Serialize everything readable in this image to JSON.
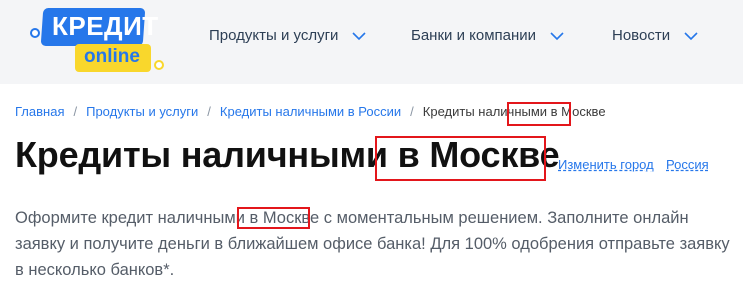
{
  "header": {
    "logo": {
      "top": "КРЕДИТ",
      "bottom": "online"
    },
    "nav": [
      {
        "label": "Продукты и услуги",
        "icon": "chevron-down-icon"
      },
      {
        "label": "Банки и компании",
        "icon": "chevron-down-icon"
      },
      {
        "label": "Новости",
        "icon": "chevron-down-icon"
      }
    ]
  },
  "breadcrumb": {
    "items": [
      "Главная",
      "Продукты и услуги",
      "Кредиты наличными в России"
    ],
    "current": "Кредиты наличными в Москве",
    "separator": "/"
  },
  "page": {
    "title": "Кредиты наличными в Москве",
    "change_city": "Изменить город",
    "region": "Россия",
    "intro": "Оформите кредит наличными в Москве с моментальным решением. Заполните онлайн заявку и получите деньги в ближайшем офисе банка! Для 100% одобрения отправьте заявку в несколько банков*."
  },
  "colors": {
    "brand_blue": "#2677ea",
    "brand_yellow": "#f9d72c",
    "highlight_red": "#e3161b"
  }
}
